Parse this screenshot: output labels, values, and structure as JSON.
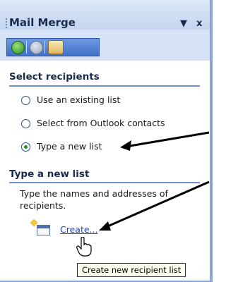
{
  "pane": {
    "title": "Mail Merge",
    "menu_glyph": "▼",
    "close_glyph": "x"
  },
  "nav": {
    "back_icon": "back-icon",
    "forward_icon": "forward-icon",
    "home_icon": "home-icon"
  },
  "select_recipients": {
    "heading": "Select recipients",
    "options": [
      {
        "label": "Use an existing list",
        "checked": false
      },
      {
        "label": "Select from Outlook contacts",
        "checked": false
      },
      {
        "label": "Type a new list",
        "checked": true
      }
    ]
  },
  "type_new_list": {
    "heading": "Type a new list",
    "description": "Type the names and addresses of recipients.",
    "create_label": "Create...",
    "tooltip": "Create new recipient list"
  },
  "colors": {
    "link": "#1b3fd1",
    "accent": "#6f8fd1",
    "pane_bg": "#d6e3f7"
  }
}
